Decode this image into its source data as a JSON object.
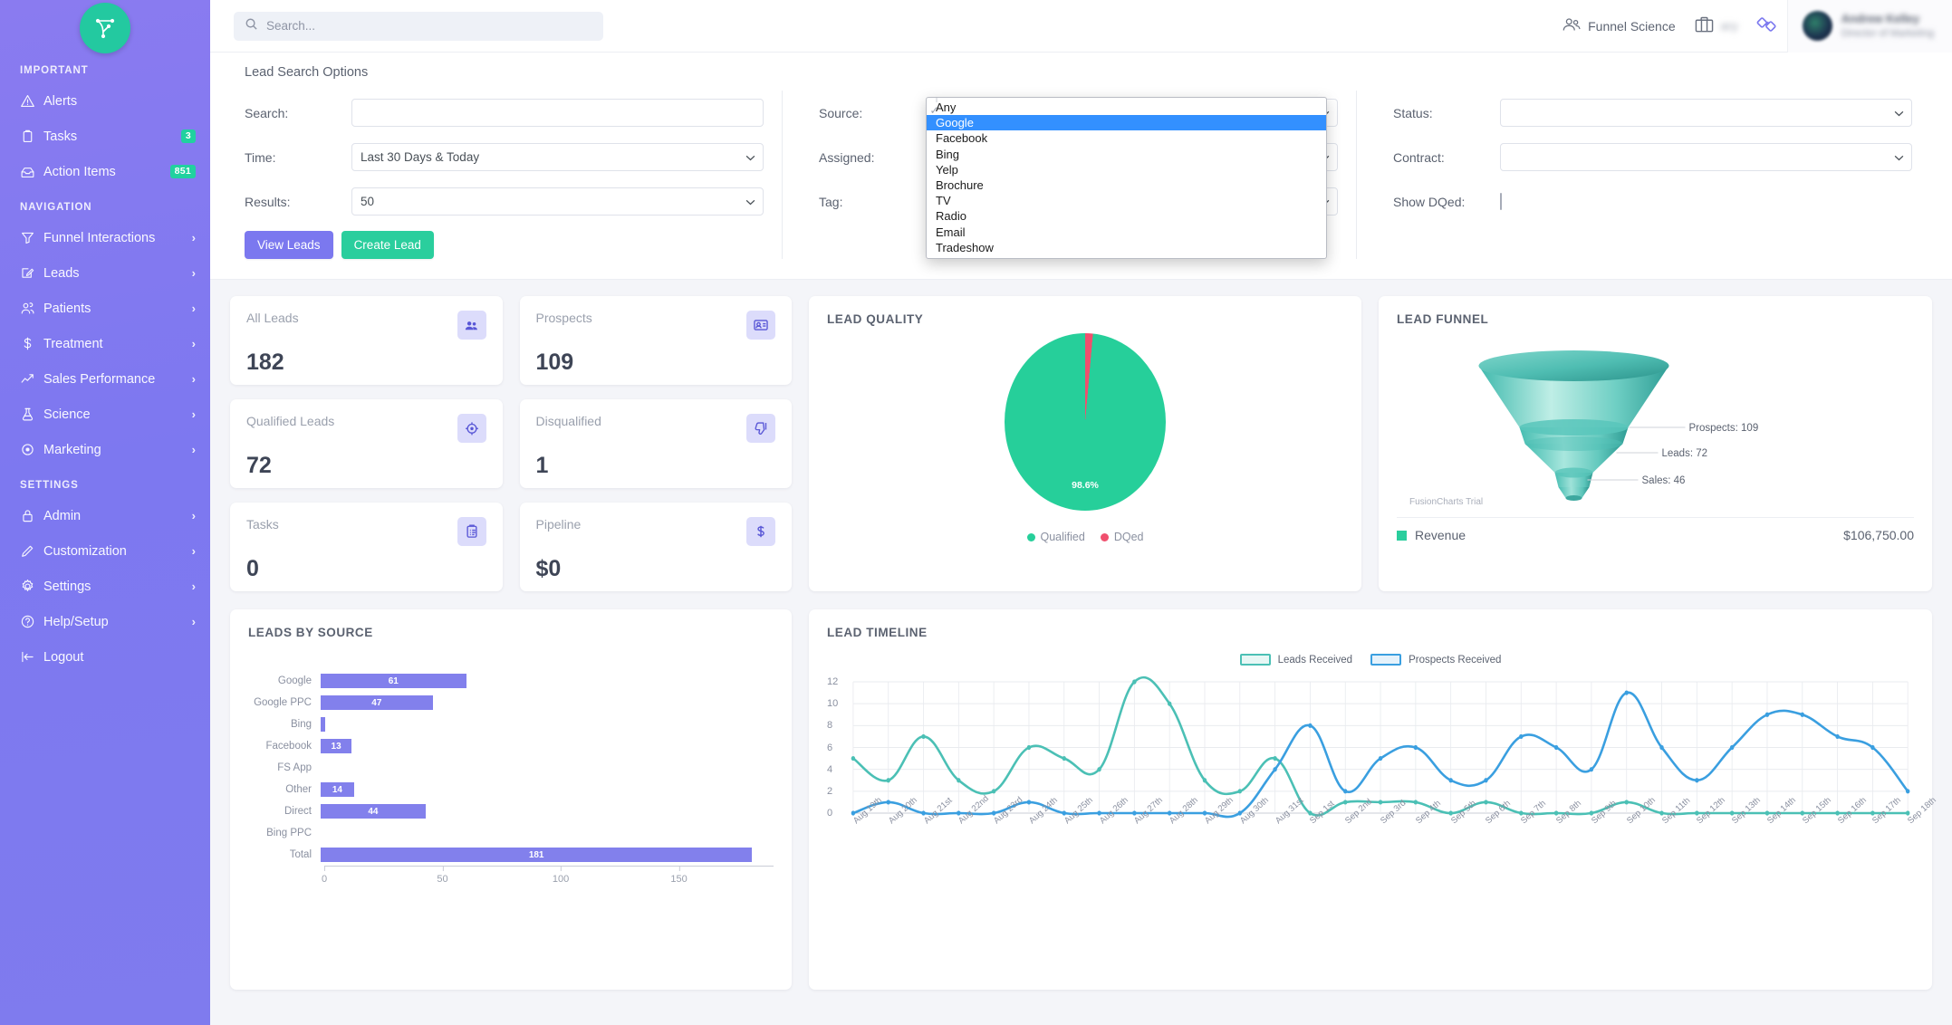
{
  "sidebar": {
    "logo_icon": "funnel-network-logo",
    "sections": [
      {
        "title": "IMPORTANT",
        "items": [
          {
            "label": "Alerts",
            "icon": "alert-triangle-icon",
            "badge": null,
            "chevron": false
          },
          {
            "label": "Tasks",
            "icon": "clipboard-icon",
            "badge": "3",
            "chevron": false
          },
          {
            "label": "Action Items",
            "icon": "inbox-icon",
            "badge": "851",
            "chevron": false
          }
        ]
      },
      {
        "title": "NAVIGATION",
        "items": [
          {
            "label": "Funnel Interactions",
            "icon": "funnel-icon",
            "badge": null,
            "chevron": true
          },
          {
            "label": "Leads",
            "icon": "edit-square-icon",
            "badge": null,
            "chevron": true
          },
          {
            "label": "Patients",
            "icon": "users-icon",
            "badge": null,
            "chevron": true
          },
          {
            "label": "Treatment",
            "icon": "dollar-icon",
            "badge": null,
            "chevron": true
          },
          {
            "label": "Sales Performance",
            "icon": "trend-up-icon",
            "badge": null,
            "chevron": true
          },
          {
            "label": "Science",
            "icon": "flask-icon",
            "badge": null,
            "chevron": true
          },
          {
            "label": "Marketing",
            "icon": "target-icon",
            "badge": null,
            "chevron": true
          }
        ]
      },
      {
        "title": "SETTINGS",
        "items": [
          {
            "label": "Admin",
            "icon": "lock-icon",
            "badge": null,
            "chevron": true
          },
          {
            "label": "Customization",
            "icon": "pencil-icon",
            "badge": null,
            "chevron": true
          },
          {
            "label": "Settings",
            "icon": "gear-icon",
            "badge": null,
            "chevron": true
          },
          {
            "label": "Help/Setup",
            "icon": "question-circle-icon",
            "badge": null,
            "chevron": true
          },
          {
            "label": "Logout",
            "icon": "logout-icon",
            "badge": null,
            "chevron": false
          }
        ]
      }
    ]
  },
  "topbar": {
    "search_placeholder": "Search...",
    "org_label": "Funnel Science",
    "org_icon": "people-group-icon",
    "briefcase_icon": "briefcase-icon",
    "briefcase_label_redacted": "ary",
    "link_icon": "link-chain-icon",
    "user_name_redacted": "Andrew Kelley",
    "user_role_redacted": "Director of Marketing"
  },
  "search_panel": {
    "title": "Lead Search Options",
    "fields": {
      "search": {
        "label": "Search:",
        "value": "",
        "placeholder": ""
      },
      "time": {
        "label": "Time:",
        "value": "Last 30 Days & Today"
      },
      "results": {
        "label": "Results:",
        "value": "50"
      },
      "source": {
        "label": "Source:",
        "value": "Any"
      },
      "assigned": {
        "label": "Assigned:",
        "value": ""
      },
      "tag": {
        "label": "Tag:",
        "value": ""
      },
      "status": {
        "label": "Status:",
        "value": ""
      },
      "contract": {
        "label": "Contract:",
        "value": ""
      },
      "show_dqed": {
        "label": "Show DQed:",
        "checked": false
      }
    },
    "source_dropdown": {
      "open": true,
      "selected_checked": "Any",
      "highlighted": "Google",
      "options": [
        "Any",
        "Google",
        "Facebook",
        "Bing",
        "Yelp",
        "Brochure",
        "TV",
        "Radio",
        "Email",
        "Tradeshow"
      ]
    },
    "buttons": {
      "view_leads": "View Leads",
      "create_lead": "Create Lead"
    }
  },
  "kpis": [
    {
      "label": "All Leads",
      "value": "182",
      "icon": "people-icon"
    },
    {
      "label": "Prospects",
      "value": "109",
      "icon": "id-card-icon"
    },
    {
      "label": "Qualified Leads",
      "value": "72",
      "icon": "target-icon"
    },
    {
      "label": "Disqualified",
      "value": "1",
      "icon": "thumbs-down-icon"
    },
    {
      "label": "Tasks",
      "value": "0",
      "icon": "clipboard-list-icon"
    },
    {
      "label": "Pipeline",
      "value": "$0",
      "icon": "dollar-sign-icon"
    }
  ],
  "lead_quality": {
    "title": "LEAD QUALITY",
    "label": "98.6%",
    "legend": [
      {
        "name": "Qualified",
        "color": "#26cf9a"
      },
      {
        "name": "DQed",
        "color": "#f0506e"
      }
    ]
  },
  "lead_funnel": {
    "title": "LEAD FUNNEL",
    "watermark": "FusionCharts Trial",
    "stages": [
      {
        "label": "Prospects: 109"
      },
      {
        "label": "Leads: 72"
      },
      {
        "label": "Sales: 46"
      }
    ],
    "revenue_label": "Revenue",
    "revenue_value": "$106,750.00"
  },
  "leads_by_source": {
    "title": "LEADS BY SOURCE"
  },
  "lead_timeline": {
    "title": "LEAD TIMELINE",
    "legend": [
      {
        "name": "Leads Received",
        "color": "#4bc0b5"
      },
      {
        "name": "Prospects Received",
        "color": "#3a9fe0"
      }
    ]
  },
  "chart_data": [
    {
      "type": "pie",
      "title": "LEAD QUALITY",
      "labels": [
        "Qualified",
        "DQed"
      ],
      "values": [
        98.6,
        1.4
      ],
      "data_labels": [
        "98.6%",
        ""
      ],
      "colors": [
        "#26cf9a",
        "#f0506e"
      ],
      "legend_position": "bottom"
    },
    {
      "type": "bar",
      "title": "LEAD FUNNEL",
      "orientation": "funnel",
      "categories": [
        "Prospects",
        "Leads",
        "Sales"
      ],
      "values": [
        109,
        72,
        46
      ],
      "annotations": [
        "Prospects: 109",
        "Leads: 72",
        "Sales: 46"
      ],
      "footer_metric": {
        "name": "Revenue",
        "value": "$106,750.00"
      },
      "watermark": "FusionCharts Trial"
    },
    {
      "type": "bar",
      "title": "LEADS BY SOURCE",
      "orientation": "horizontal",
      "categories": [
        "Google",
        "Google PPC",
        "Bing",
        "Facebook",
        "FS App",
        "Other",
        "Direct",
        "Bing PPC",
        "Total"
      ],
      "values": [
        61,
        47,
        2,
        13,
        0,
        14,
        44,
        0,
        181
      ],
      "data_labels": [
        "61",
        "47",
        "",
        "13",
        "",
        "14",
        "44",
        "",
        "181"
      ],
      "xlabel": "",
      "ylabel": "",
      "xlim": [
        0,
        190
      ],
      "xticks": [
        0,
        50,
        100,
        150
      ],
      "grid": true,
      "color": "#8280ec"
    },
    {
      "type": "line",
      "title": "LEAD TIMELINE",
      "x": [
        "Aug 19th",
        "Aug 20th",
        "Aug 21st",
        "Aug 22nd",
        "Aug 23rd",
        "Aug 24th",
        "Aug 25th",
        "Aug 26th",
        "Aug 27th",
        "Aug 28th",
        "Aug 29th",
        "Aug 30th",
        "Aug 31st",
        "Sep 1st",
        "Sep 2nd",
        "Sep 3rd",
        "Sep 4th",
        "Sep 5th",
        "Sep 6th",
        "Sep 7th",
        "Sep 8th",
        "Sep 9th",
        "Sep 10th",
        "Sep 11th",
        "Sep 12th",
        "Sep 13th",
        "Sep 14th",
        "Sep 15th",
        "Sep 16th",
        "Sep 17th",
        "Sep 18th"
      ],
      "series": [
        {
          "name": "Leads Received",
          "color": "#4bc0b5",
          "values": [
            5,
            3,
            7,
            3,
            2,
            6,
            5,
            4,
            12,
            10,
            3,
            2,
            5,
            0,
            1,
            1,
            1,
            0,
            1,
            0,
            0,
            0,
            1,
            0,
            0,
            0,
            0,
            0,
            0,
            0,
            0
          ]
        },
        {
          "name": "Prospects Received",
          "color": "#3a9fe0",
          "values": [
            0,
            1,
            0,
            0,
            0,
            1,
            0,
            0,
            0,
            0,
            0,
            0,
            4,
            8,
            2,
            5,
            6,
            3,
            3,
            7,
            6,
            4,
            11,
            6,
            3,
            6,
            9,
            9,
            7,
            6,
            2
          ]
        }
      ],
      "ylim": [
        0,
        12
      ],
      "yticks": [
        0,
        2,
        4,
        6,
        8,
        10,
        12
      ],
      "grid": true,
      "legend_position": "top"
    }
  ]
}
